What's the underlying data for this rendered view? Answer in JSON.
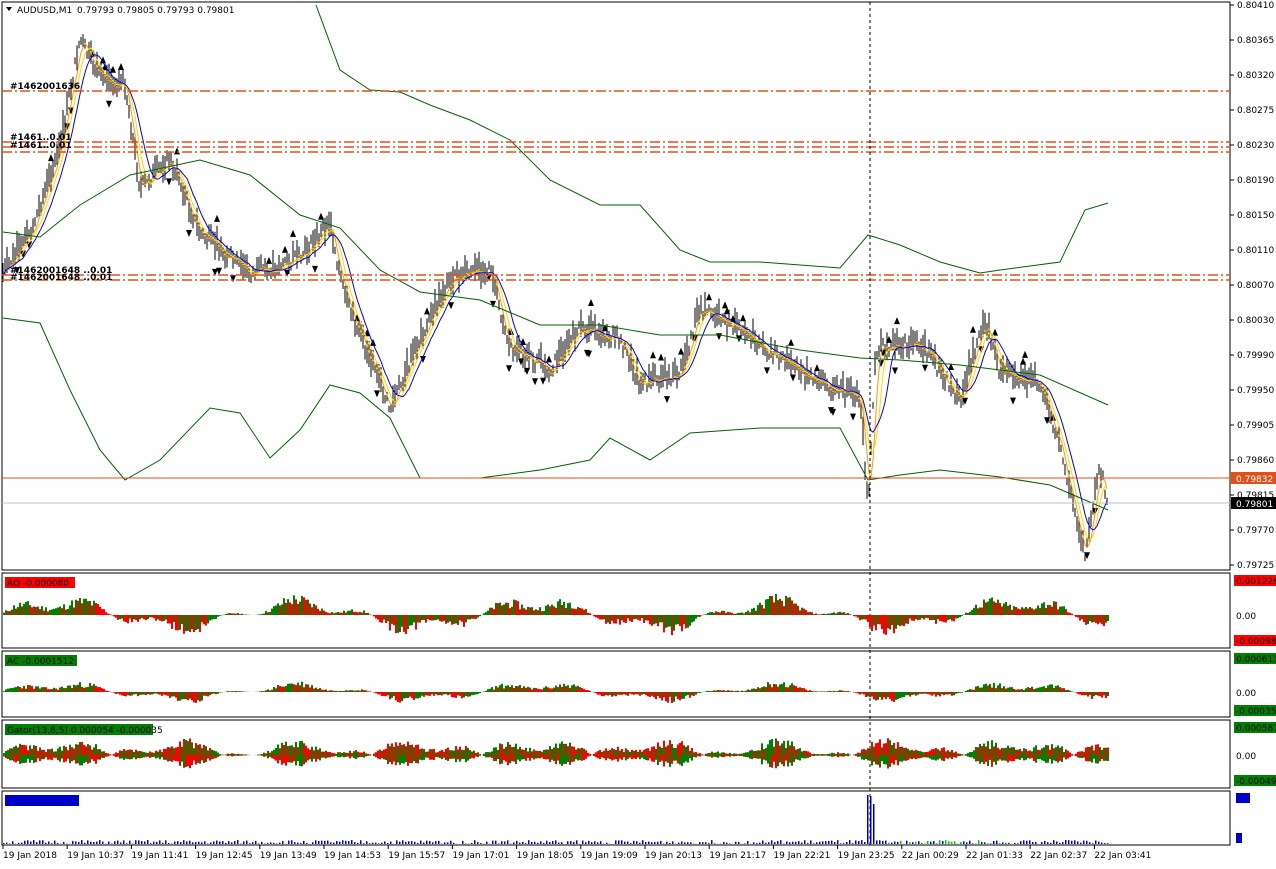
{
  "symbol_header": {
    "symbol": "AUDUSD,M1",
    "quotes": "0.79793 0.79805 0.79793 0.79801"
  },
  "colors": {
    "background": "#ffffff",
    "candle": "#000000",
    "fast_ma": "#ff9900",
    "slow_ma": "#0000ff",
    "mid_ma": "#ffd700",
    "envelope": "#006400",
    "order_level": "#e0501a",
    "bid_line": "#c0c0c0",
    "ao_up": "#008000",
    "ao_down": "#ff0000",
    "volume": "#0000cc",
    "volume_small": "#00cc00"
  },
  "price_axis": {
    "ticks": [
      "0.80410",
      "0.80365",
      "0.80320",
      "0.80275",
      "0.80230",
      "0.80190",
      "0.80150",
      "0.80110",
      "0.80070",
      "0.80030",
      "0.79990",
      "0.79950",
      "0.79905",
      "0.79860",
      "0.79815",
      "0.79770",
      "0.79725"
    ],
    "order_label": "0.79832",
    "bid_label": "0.79801"
  },
  "order_tags": [
    {
      "text": "#1462001636"
    },
    {
      "text": "#1461..0.01"
    },
    {
      "text": "#1462001648 ..0.01"
    }
  ],
  "time_axis": [
    "19 Jan 2018",
    "19 Jan 10:37",
    "19 Jan 11:41",
    "19 Jan 12:45",
    "19 Jan 13:49",
    "19 Jan 14:53",
    "19 Jan 15:57",
    "19 Jan 17:01",
    "19 Jan 18:05",
    "19 Jan 19:09",
    "19 Jan 20:13",
    "19 Jan 21:17",
    "19 Jan 22:21",
    "19 Jan 23:25",
    "22 Jan 00:29",
    "22 Jan 01:33",
    "22 Jan 02:37",
    "22 Jan 03:41"
  ],
  "ao_pane": {
    "label": "AO -0.000080",
    "scale_top": "0.001226",
    "scale_mid": "0.00",
    "scale_bottom": "-0.00098"
  },
  "ac_pane": {
    "label": "AC -0.0001512",
    "scale_top": "0.000613",
    "scale_mid": "0.00",
    "scale_bottom": "-0.00035"
  },
  "gator_pane": {
    "label": "Gator(13,8,5) 0.000054 -0.000035",
    "scale_top": "0.000587",
    "scale_mid": "0.00",
    "scale_bottom": "-0.00049"
  },
  "volume_pane": {
    "label": "Vol MT (1.0%)"
  }
}
